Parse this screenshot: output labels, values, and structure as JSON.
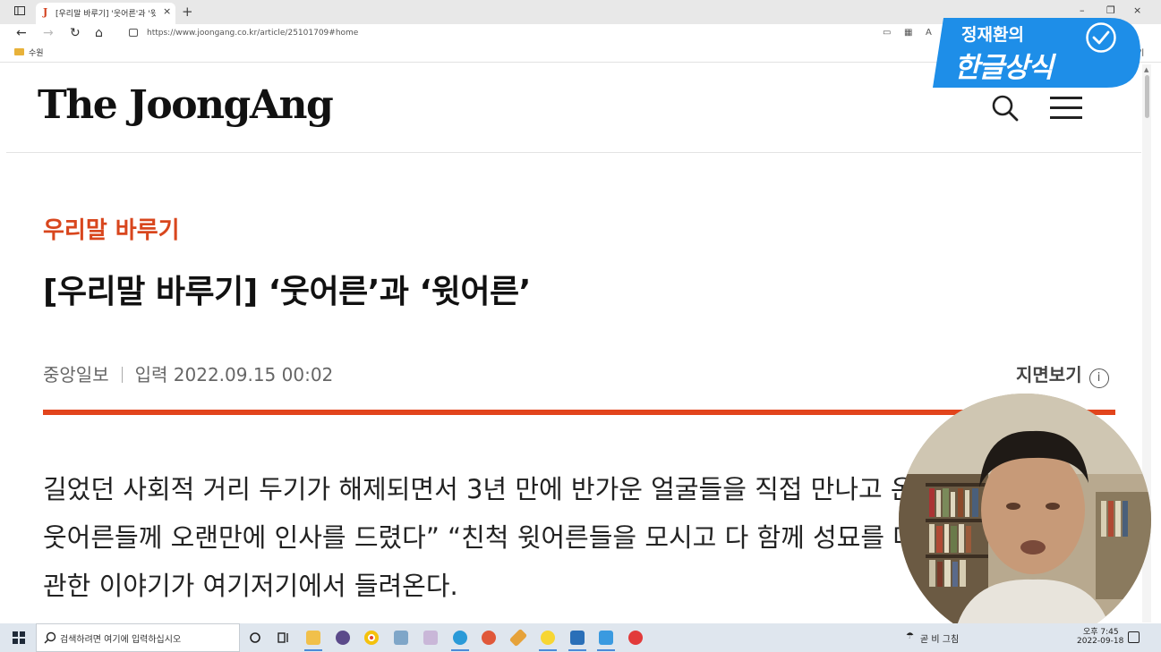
{
  "browser": {
    "tab": {
      "favicon": "J",
      "title": "[우리말 바루기] '웃어른'과 '윗어",
      "close": "×"
    },
    "new_tab": "+",
    "window_controls": {
      "minimize": "–",
      "maximize": "❐",
      "close": "×"
    },
    "url": "https://www.joongang.co.kr/article/25101709#home",
    "bookmarks": [
      {
        "label": "수원",
        "icon": "folder-icon"
      }
    ],
    "bookmarks_right": "기"
  },
  "site": {
    "logo": "The JoongAng",
    "header_icons": [
      "search-icon",
      "hamburger-menu-icon"
    ]
  },
  "article": {
    "category": "우리말 바루기",
    "headline": "[우리말 바루기] ‘웃어른’과 ‘윗어른’",
    "source": "중앙일보",
    "published": "입력 2022.09.15 00:02",
    "paper_view": "지면보기",
    "paper_view_icon": "i",
    "body_lines": [
      "길었던 사회적 거리 두기가 해제되면서 3년 만에 반가운 얼굴들을 직접 만나고 온 추",
      "웃어른들께 오랜만에 인사를 드렸다” “친척 윗어른들을 모시고 다 함께 성묘를 다녀",
      "관한 이야기가 여기저기에서 들려온다."
    ]
  },
  "overlay": {
    "channel_name": "정재환의",
    "channel_title": "한글상식"
  },
  "taskbar": {
    "search_placeholder": "검색하려면 여기에 입력하십시오",
    "apps": [
      "cortana-icon",
      "task-view-icon",
      "file-explorer-icon",
      "firefox-icon",
      "chrome-icon",
      "app-icon",
      "paint-icon",
      "edge-icon",
      "app-icon",
      "pen-icon",
      "kakaotalk-icon",
      "photos-icon",
      "notes-icon",
      "red-app-icon"
    ],
    "weather": "곧 비 그침",
    "clock_time": "오후 7:45",
    "clock_date": "2022-09-18"
  },
  "colors": {
    "accent_red": "#d8461d",
    "rule_red": "#e2441c",
    "badge_blue": "#1e8ee8"
  }
}
